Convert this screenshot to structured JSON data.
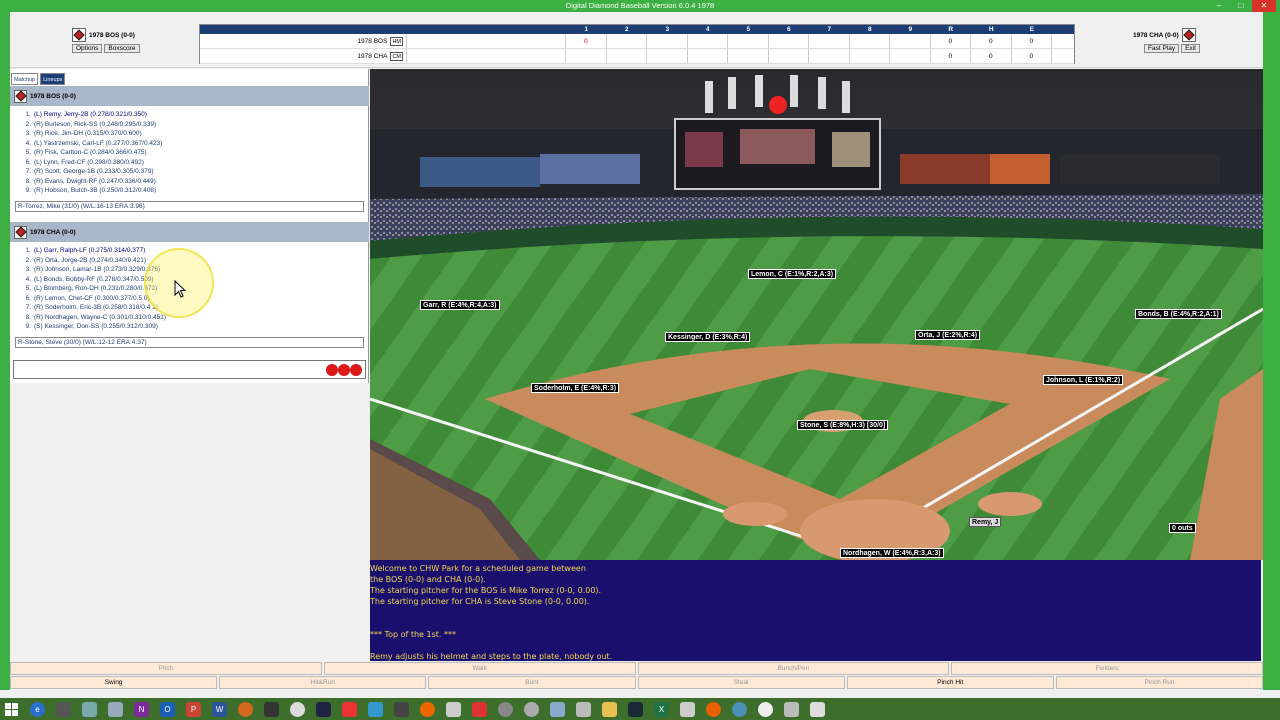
{
  "window": {
    "title": "Digital Diamond Baseball Version 6.0.4 1978"
  },
  "header": {
    "away": {
      "label": "1978 BOS (0-0)",
      "options_label": "Options",
      "boxscore_label": "Boxscore"
    },
    "home": {
      "label": "1978 CHA (0-0)",
      "fastplay_label": "Fast Play",
      "exit_label": "Exit"
    }
  },
  "linescore": {
    "innings": [
      "1",
      "2",
      "3",
      "4",
      "5",
      "6",
      "7",
      "8",
      "9",
      "R",
      "H",
      "E"
    ],
    "rows": [
      {
        "team": "1978 BOS",
        "tag": "HM",
        "cells": [
          "0",
          "",
          "",
          "",
          "",
          "",
          "",
          "",
          "",
          "0",
          "0",
          "0"
        ]
      },
      {
        "team": "1978 CHA",
        "tag": "CM",
        "cells": [
          "",
          "",
          "",
          "",
          "",
          "",
          "",
          "",
          "",
          "0",
          "0",
          "0"
        ]
      }
    ]
  },
  "tabs": {
    "matchup": "Matchup",
    "lineups": "Lineups"
  },
  "bos": {
    "title": "1978 BOS (0-0)",
    "lineup": [
      "(L) Remy, Jerry-2B (0.278/0.321/0.350)",
      "(R) Burleson, Rick-SS (0.248/0.295/0.339)",
      "(R) Rice, Jim-DH (0.315/0.370/0.600)",
      "(L) Yastrzemski, Carl-LF (0.277/0.367/0.423)",
      "(R) Fisk, Carlton-C (0.284/0.366/0.475)",
      "(L) Lynn, Fred-CF (0.298/0.380/0.492)",
      "(R) Scott, George-1B (0.233/0.305/0.379)",
      "(R) Evans, Dwight-RF (0.247/0.336/0.449)",
      "(R) Hobson, Butch-3B (0.250/0.312/0.408)"
    ],
    "pitcher": "R-Torrez, Mike (31/0) (W/L:16-13 ERA:3.96)"
  },
  "cha": {
    "title": "1978 CHA (0-0)",
    "lineup": [
      "(L) Garr, Ralph-LF (0.275/0.314/0.377)",
      "(R) Orta, Jorge-2B (0.274/0.340/0.421)",
      "(R) Johnson, Lamar-1B (0.273/0.329/0.376)",
      "(L) Bonds, Bobby-RF (0.278/0.347/0.509)",
      "(L) Blomberg, Ron-DH (0.231/0.280/0.372)",
      "(R) Lemon, Chet-CF (0.300/0.377/0.5 0)",
      "(R) Soderholm, Eric-3B (0.258/0.318/0.4 1)",
      "(R) Nordhagen, Wayne-C (0.301/0.310/0.451)",
      "(S) Kessinger, Don-SS (0.255/0.312/0.309)"
    ],
    "pitcher": "R-Stone, Steve (30/0) (W/L:12-12 ERA:4.37)"
  },
  "field_labels": {
    "lemon": "Lemon, C (E:1%,R:2,A:3)",
    "garr": "Garr, R (E:4%,R:4,A:3)",
    "bonds": "Bonds, B (E:4%,R:2,A:1)",
    "kessinger": "Kessinger, D (E:3%,R:4)",
    "orta": "Orta, J (E:2%,R:4)",
    "soderholm": "Soderholm, E (E:4%,R:3)",
    "johnson": "Johnson, L (E:1%,R:2)",
    "stone": "Stone, S (E:8%,H:3) [30/0]",
    "remy": "Remy, J",
    "outs": "0 outs",
    "nordhagen": "Nordhagen, W (E:4%,R:3,A:3)"
  },
  "pbp": [
    "Welcome to CHW Park for a scheduled game between",
    "the BOS (0-0) and CHA (0-0).",
    "The starting pitcher for the BOS is Mike Torrez (0-0, 0.00).",
    "The starting pitcher for CHA is Steve Stone (0-0, 0.00).",
    "",
    "",
    "*** Top of the 1st. ***",
    "",
    "Remy adjusts his helmet and steps to the plate, nobody out."
  ],
  "buttons_row1": [
    "Pitch",
    "Walk",
    "Bunch/Pen",
    "Fielders"
  ],
  "buttons_row2": [
    "Swing",
    "Hit&Run",
    "Bunt",
    "Steal",
    "Pinch Hit",
    "Pinch Run"
  ],
  "outs_count": 3,
  "colors": {
    "accent": "#1d3d76",
    "pbp_bg": "#1b0f6e",
    "pbp_text": "#f0d850",
    "edge": "#3cb043"
  }
}
